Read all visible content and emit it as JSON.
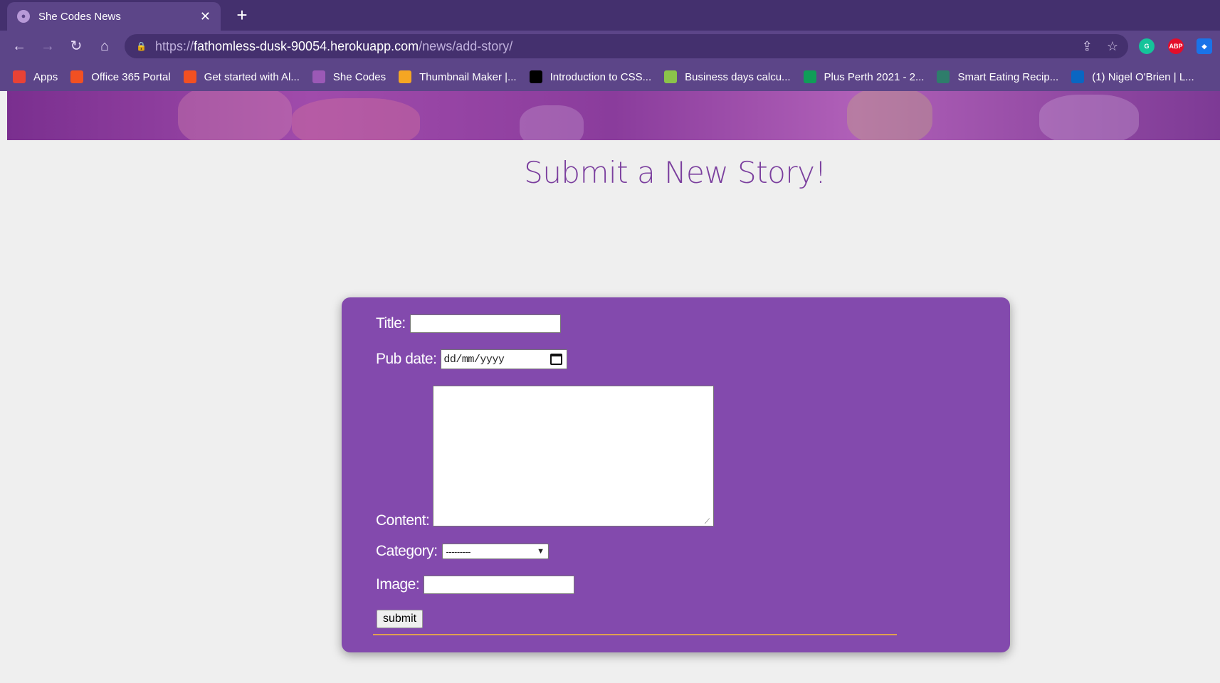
{
  "browser": {
    "tab_title": "She Codes News",
    "tab_close": "✕",
    "new_tab": "+",
    "url_scheme": "https://",
    "url_host": "fathomless-dusk-90054.herokuapp.com",
    "url_path": "/news/add-story/",
    "back": "←",
    "forward": "→",
    "reload": "↻",
    "home": "⌂",
    "lock": "🔒",
    "share": "⇪",
    "star": "☆",
    "extensions": [
      {
        "label": "G",
        "color": "#15c39a"
      },
      {
        "label": "ABP",
        "color": "#e40d2a"
      },
      {
        "label": "◆",
        "color": "#1a73e8"
      }
    ]
  },
  "bookmarks": [
    {
      "label": "Apps",
      "color": "#e94235"
    },
    {
      "label": "Office 365 Portal",
      "color": "#f25022"
    },
    {
      "label": "Get started with Al...",
      "color": "#f25022"
    },
    {
      "label": "She Codes",
      "color": "#9b59b6"
    },
    {
      "label": "Thumbnail Maker |...",
      "color": "#f5a623"
    },
    {
      "label": "Introduction to CSS...",
      "color": "#000000"
    },
    {
      "label": "Business days calcu...",
      "color": "#8bc34a"
    },
    {
      "label": "Plus Perth 2021 - 2...",
      "color": "#0f9d58"
    },
    {
      "label": "Smart Eating Recip...",
      "color": "#2e7d6b"
    },
    {
      "label": "(1) Nigel O'Brien | L...",
      "color": "#0a66c2"
    }
  ],
  "page": {
    "title": "Submit a New Story!",
    "form": {
      "title_label": "Title:",
      "title_value": "",
      "pub_date_label": "Pub date:",
      "pub_date_placeholder": "dd/mm/yyyy",
      "content_label": "Content:",
      "content_value": "",
      "category_label": "Category:",
      "category_selected": "---------",
      "image_label": "Image:",
      "image_value": "",
      "submit_label": "submit"
    }
  },
  "colors": {
    "brand_purple": "#834aad",
    "title_purple": "#7b3f9e",
    "accent_orange": "#e0a050"
  }
}
